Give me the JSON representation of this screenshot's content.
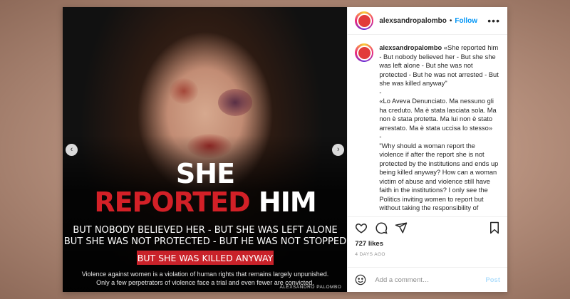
{
  "post": {
    "image": {
      "headline_line1": "SHE",
      "headline_red": "REPORTED",
      "headline_white": "HIM",
      "sub_line1": "BUT NOBODY BELIEVED HER - BUT SHE WAS LEFT ALONE",
      "sub_line2": "BUT SHE WAS NOT PROTECTED - BUT HE WAS NOT STOPPED",
      "killed_banner": "BUT SHE WAS KILLED ANYWAY",
      "footer_line1": "Violence against women is a violation of human rights that remains largely unpunished.",
      "footer_line2": "Only a few perpetrators of violence face a trial and even fewer are convicted.",
      "credit": "ALEXSANDRO PALOMBO",
      "prev_arrow": "‹",
      "next_arrow": "›"
    },
    "header": {
      "username": "alexsandropalombo",
      "dot": "•",
      "follow_label": "Follow",
      "more_label": "•••"
    },
    "caption": {
      "username": "alexsandropalombo",
      "para1": "«She reported him - But nobody believed her - But she she was left alone - But she was not protected - But he was not arrested - But she was killed anyway\"",
      "sep1": "-",
      "para2": "«Lo Aveva Denunciato. Ma nessuno gli ha creduto. Ma è stata lasciata sola. Ma non è stata protetta. Ma lui non è stato arrestato. Ma è stata uccisa lo stesso»",
      "sep2": "-",
      "para3": "\"Why should a woman report the violence if after the report she is not protected by the institutions and ends up being killed anyway? How can a woman victim of abuse and violence still have faith in the institutions? I only see the Politics inviting women to report but without taking the responsibility of"
    },
    "likes": "727 likes",
    "date": "4 DAYS AGO",
    "comment": {
      "placeholder": "Add a comment…",
      "post_label": "Post"
    },
    "icons": {
      "like": "heart-icon",
      "comment": "comment-icon",
      "share": "share-icon",
      "save": "bookmark-icon",
      "emoji": "emoji-icon"
    },
    "colors": {
      "accent": "#0095f6",
      "banner_red": "#c9222a",
      "headline_red": "#d32027"
    }
  }
}
